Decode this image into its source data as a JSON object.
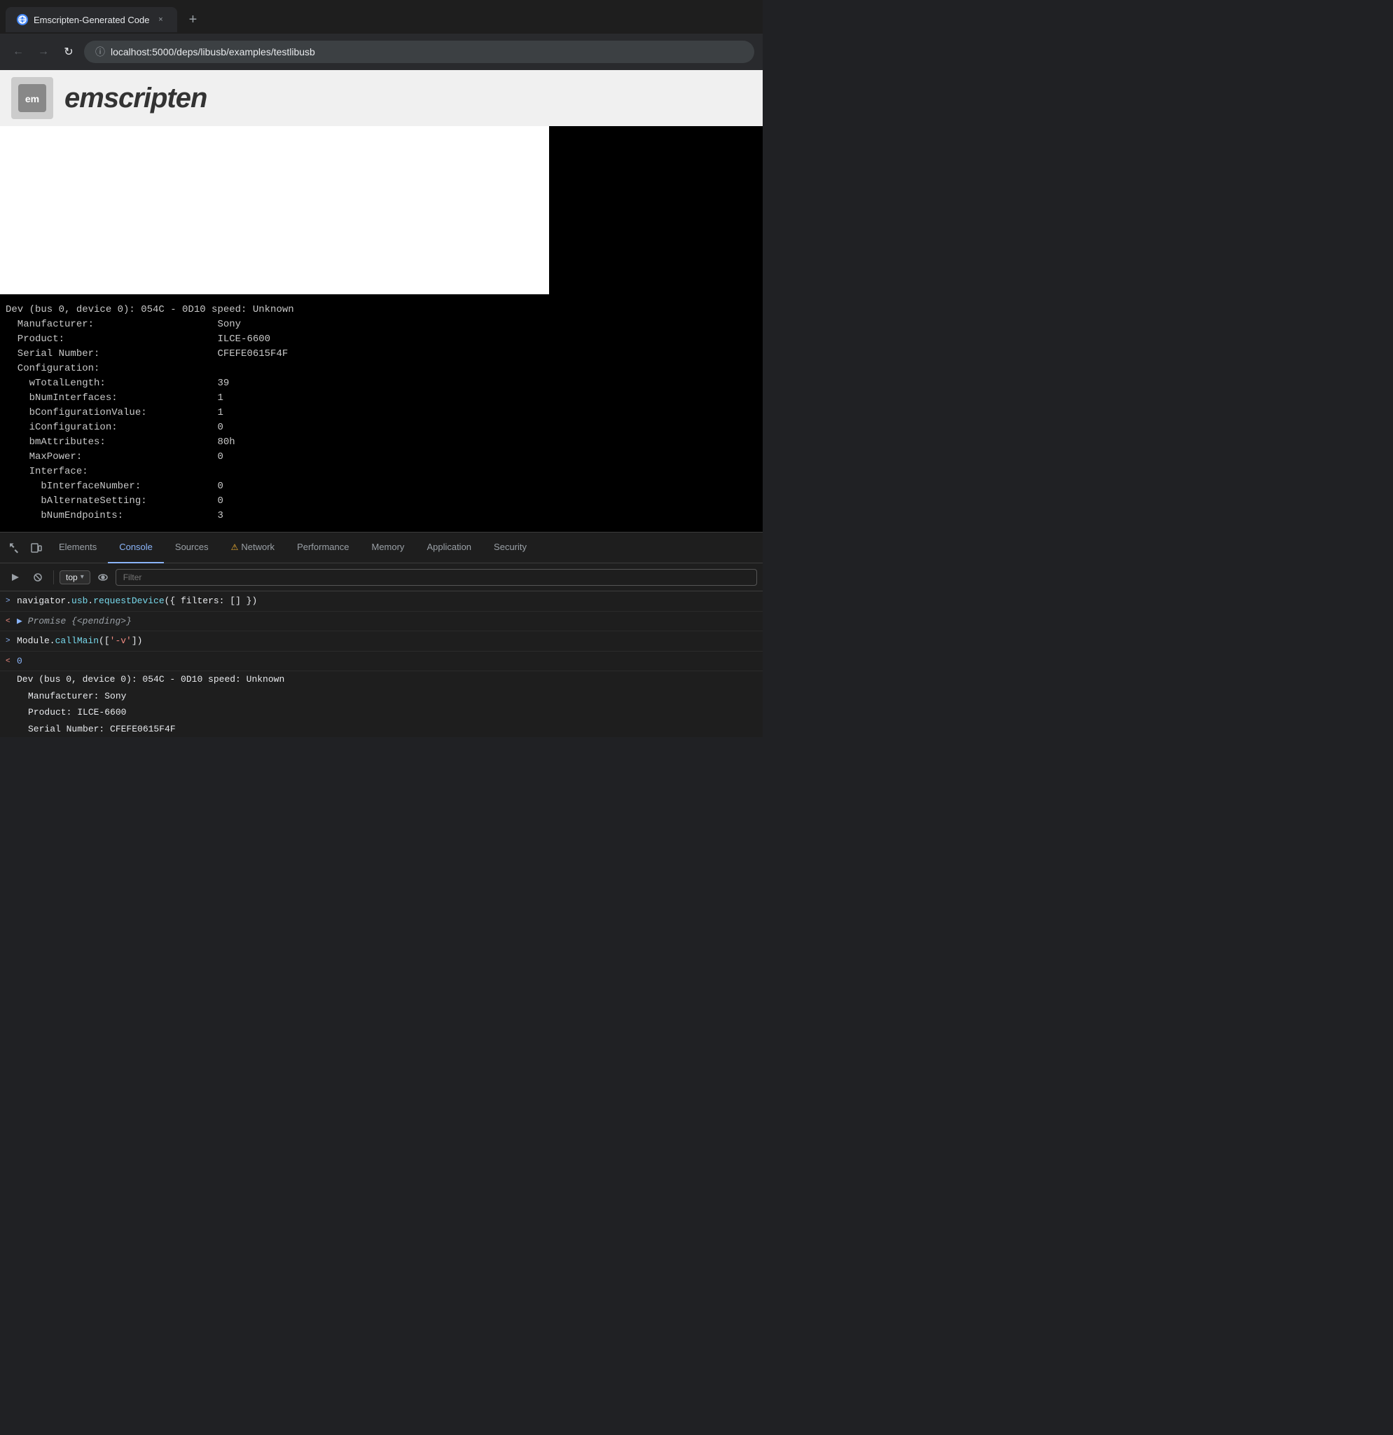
{
  "browser": {
    "tab": {
      "title": "Emscripten-Generated Code",
      "favicon": "🌐",
      "close_label": "×",
      "new_tab_label": "+"
    },
    "nav": {
      "back_label": "←",
      "forward_label": "→",
      "reload_label": "↻",
      "url": "localhost:5000/deps/libusb/examples/testlibusb",
      "secure_icon": "ⓘ"
    }
  },
  "page": {
    "logo_text": "emscripten",
    "canvas_alt": "Emscripten canvas output"
  },
  "terminal": {
    "lines": [
      "Dev (bus 0, device 0): 054C - 0D10 speed: Unknown",
      "  Manufacturer:                     Sony",
      "  Product:                          ILCE-6600",
      "  Serial Number:                    CFEFE0615F4F",
      "  Configuration:",
      "    wTotalLength:                   39",
      "    bNumInterfaces:                 1",
      "    bConfigurationValue:            1",
      "    iConfiguration:                 0",
      "    bmAttributes:                   80h",
      "    MaxPower:                       0",
      "    Interface:",
      "      bInterfaceNumber:             0",
      "      bAlternateSetting:            0",
      "      bNumEndpoints:                3"
    ]
  },
  "devtools": {
    "tabs": [
      {
        "id": "elements",
        "label": "Elements",
        "active": false,
        "warning": false
      },
      {
        "id": "console",
        "label": "Console",
        "active": true,
        "warning": false
      },
      {
        "id": "sources",
        "label": "Sources",
        "active": false,
        "warning": false
      },
      {
        "id": "network",
        "label": "Network",
        "active": false,
        "warning": true
      },
      {
        "id": "performance",
        "label": "Performance",
        "active": false,
        "warning": false
      },
      {
        "id": "memory",
        "label": "Memory",
        "active": false,
        "warning": false
      },
      {
        "id": "application",
        "label": "Application",
        "active": false,
        "warning": false
      },
      {
        "id": "security",
        "label": "Security",
        "active": false,
        "warning": false
      }
    ],
    "console_toolbar": {
      "context": "top",
      "filter_placeholder": "Filter"
    },
    "console_entries": [
      {
        "type": "input",
        "arrow": ">",
        "content_parts": [
          {
            "text": "navigator.",
            "class": "white"
          },
          {
            "text": "usb",
            "class": "cyan"
          },
          {
            "text": ".",
            "class": "white"
          },
          {
            "text": "requestDevice",
            "class": "cyan"
          },
          {
            "text": "({ filters: [] })",
            "class": "white"
          }
        ]
      },
      {
        "type": "output",
        "arrow": "<",
        "content_parts": [
          {
            "text": "▶ ",
            "class": "blue"
          },
          {
            "text": "Promise {<pending>}",
            "class": "italic gray"
          }
        ]
      },
      {
        "type": "input",
        "arrow": ">",
        "content_parts": [
          {
            "text": "Module",
            "class": "white"
          },
          {
            "text": ".",
            "class": "white"
          },
          {
            "text": "callMain",
            "class": "cyan"
          },
          {
            "text": "([",
            "class": "white"
          },
          {
            "text": "'-v'",
            "class": "orange"
          },
          {
            "text": "])",
            "class": "white"
          }
        ]
      },
      {
        "type": "output_value",
        "arrow": "<",
        "content_parts": [
          {
            "text": "0",
            "class": "blue"
          }
        ]
      }
    ],
    "output_lines": [
      {
        "label": "Dev (bus 0, device 0): 054C - 0D10 speed: Unknown"
      },
      {
        "label": "  Manufacturer:                     Sony"
      },
      {
        "label": "  Product:                          ILCE-6600"
      },
      {
        "label": "  Serial Number:                    CFEFE0615F4F"
      }
    ]
  }
}
